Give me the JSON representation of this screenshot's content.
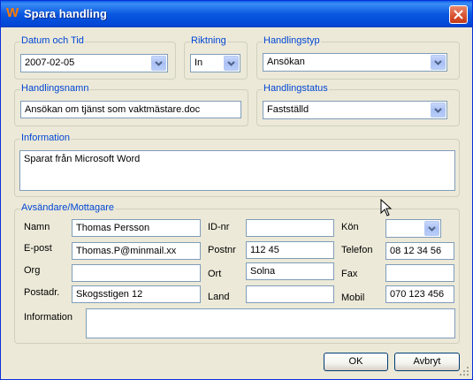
{
  "window": {
    "title": "Spara handling",
    "logo": "W"
  },
  "datum": {
    "legend": "Datum och Tid",
    "value": "2007-02-05"
  },
  "riktning": {
    "legend": "Riktning",
    "value": "In"
  },
  "handlingstyp": {
    "legend": "Handlingstyp",
    "value": "Ansökan"
  },
  "handlingsnamn": {
    "legend": "Handlingsnamn",
    "value": "Ansökan om tjänst som vaktmästare.doc"
  },
  "handlingstatus": {
    "legend": "Handlingstatus",
    "value": "Fastställd"
  },
  "information": {
    "legend": "Information",
    "value": "Sparat från Microsoft Word"
  },
  "contact": {
    "legend": "Avsändare/Mottagare",
    "namn_label": "Namn",
    "namn": "Thomas Persson",
    "epost_label": "E-post",
    "epost": "Thomas.P@minmail.xx",
    "org_label": "Org",
    "org": "",
    "postadr_label": "Postadr.",
    "postadr": "Skogsstigen 12",
    "idnr_label": "ID-nr",
    "idnr": "",
    "postnr_label": "Postnr",
    "postnr": "112 45",
    "ort_label": "Ort",
    "ort": "Solna",
    "land_label": "Land",
    "land": "",
    "kon_label": "Kön",
    "kon": "",
    "telefon_label": "Telefon",
    "telefon": "08 12 34 56",
    "fax_label": "Fax",
    "fax": "",
    "mobil_label": "Mobil",
    "mobil": "070 123 456",
    "info_label": "Information",
    "info": ""
  },
  "buttons": {
    "ok": "OK",
    "cancel": "Avbryt"
  },
  "colors": {
    "titlebar": "#0a58e0",
    "legend": "#0046d5",
    "close": "#d8502e",
    "face": "#ece9d8"
  }
}
